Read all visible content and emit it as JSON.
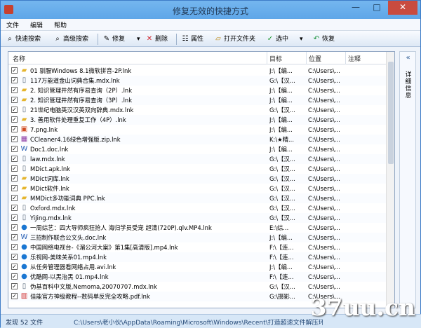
{
  "window": {
    "title": "修复无效的快捷方式",
    "controls": [
      "—",
      "□",
      "✕"
    ]
  },
  "menu": [
    "文件",
    "编辑",
    "帮助"
  ],
  "toolbar": {
    "quick_search": "快速搜索",
    "advanced_search": "高级搜索",
    "repair": "修复",
    "delete": "删除",
    "properties": "属性",
    "open_folder": "打开文件夹",
    "select": "选中",
    "restore": "恢复"
  },
  "icons": {
    "quick_search": "search-icon",
    "advanced_search": "search-icon",
    "repair": "wrench-icon",
    "delete": "delete-x-icon",
    "properties": "properties-icon",
    "open_folder": "folder-icon",
    "select": "check-icon",
    "restore": "restore-icon"
  },
  "table": {
    "headers": [
      "名称",
      "目标",
      "位置",
      "注释"
    ],
    "rows": [
      {
        "checked": true,
        "icon": "folder-icon",
        "name": "01 驯服Windows 8.1微软拼音-2P.lnk",
        "target": "J:\\【编...",
        "location": "C:\\Users\\..."
      },
      {
        "checked": true,
        "icon": "doc-icon",
        "name": "117万能道金山词典合集.mdx.lnk",
        "target": "G:\\【汉...",
        "location": "C:\\Users\\..."
      },
      {
        "checked": true,
        "icon": "folder-icon",
        "name": "2. 知识管理井然有序易查询（2P）.lnk",
        "target": "J:\\【编...",
        "location": "C:\\Users\\..."
      },
      {
        "checked": true,
        "icon": "folder-icon",
        "name": "2. 知识管理井然有序易查询（3P）.lnk",
        "target": "J:\\【编...",
        "location": "C:\\Users\\..."
      },
      {
        "checked": true,
        "icon": "doc-icon",
        "name": "21世纪电脑英汉汉英双向辞典.mdx.lnk",
        "target": "G:\\【汉...",
        "location": "C:\\Users\\..."
      },
      {
        "checked": true,
        "icon": "folder-icon",
        "name": "3. 善用软件处理重复工作（4P）.lnk",
        "target": "J:\\【编...",
        "location": "C:\\Users\\..."
      },
      {
        "checked": true,
        "icon": "png-icon",
        "name": "7.png.lnk",
        "target": "J:\\【编...",
        "location": "C:\\Users\\..."
      },
      {
        "checked": true,
        "icon": "zip-icon",
        "name": "CCleaner4.16绿色增强版.zip.lnk",
        "target": "K:\\★精...",
        "location": "C:\\Users\\..."
      },
      {
        "checked": true,
        "icon": "word-icon",
        "name": "Doc1.doc.lnk",
        "target": "J:\\【编...",
        "location": "C:\\Users\\..."
      },
      {
        "checked": true,
        "icon": "doc-icon",
        "name": "law.mdx.lnk",
        "target": "G:\\【汉...",
        "location": "C:\\Users\\..."
      },
      {
        "checked": true,
        "icon": "doc-icon",
        "name": "MDict.apk.lnk",
        "target": "G:\\【汉...",
        "location": "C:\\Users\\..."
      },
      {
        "checked": true,
        "icon": "folder-icon",
        "name": "MDict词库.lnk",
        "target": "G:\\【汉...",
        "location": "C:\\Users\\..."
      },
      {
        "checked": true,
        "icon": "folder-icon",
        "name": "MDict软件.lnk",
        "target": "G:\\【汉...",
        "location": "C:\\Users\\..."
      },
      {
        "checked": true,
        "icon": "folder-icon",
        "name": "MMDict多功能词典 PPC.lnk",
        "target": "G:\\【汉...",
        "location": "C:\\Users\\..."
      },
      {
        "checked": true,
        "icon": "doc-icon",
        "name": "Oxford.mdx.lnk",
        "target": "G:\\【汉...",
        "location": "C:\\Users\\..."
      },
      {
        "checked": true,
        "icon": "doc-icon",
        "name": "YiJing.mdx.lnk",
        "target": "G:\\【汉...",
        "location": "C:\\Users\\..."
      },
      {
        "checked": true,
        "icon": "video-icon",
        "name": "一周综艺：四大导师疯狂抢人 海归学员受宠 超清(720P).qlv.MP4.lnk",
        "target": "E:\\综...",
        "location": "C:\\Users\\..."
      },
      {
        "checked": true,
        "icon": "word-icon",
        "name": "三招制作联合公文头.doc.lnk",
        "target": "J:\\【编...",
        "location": "C:\\Users\\..."
      },
      {
        "checked": true,
        "icon": "video-icon",
        "name": "中国网络电视台-《湄公河大案》第1集[高清版].mp4.lnk",
        "target": "F:\\【连...",
        "location": "C:\\Users\\..."
      },
      {
        "checked": true,
        "icon": "video-icon",
        "name": "乐视网-美味关系01.mp4.lnk",
        "target": "F:\\【连...",
        "location": "C:\\Users\\..."
      },
      {
        "checked": true,
        "icon": "video-icon",
        "name": "从任务管理器看网络占用.avi.lnk",
        "target": "J:\\【编...",
        "location": "C:\\Users\\..."
      },
      {
        "checked": true,
        "icon": "video-icon",
        "name": "优酷网-以黑治黑 01.mp4.lnk",
        "target": "F:\\【连...",
        "location": "C:\\Users\\..."
      },
      {
        "checked": true,
        "icon": "doc-icon",
        "name": "伪基百科中文版,Nemoma,20070707.mdx.lnk",
        "target": "G:\\【汉...",
        "location": "C:\\Users\\..."
      },
      {
        "checked": true,
        "icon": "pdf-icon",
        "name": "佳能官方神级教程--数码单反完全攻略.pdf.lnk",
        "target": "G:\\摄影...",
        "location": "C:\\Users\\..."
      }
    ]
  },
  "side_panel": {
    "collapse_icon": "«",
    "label": "详细信息"
  },
  "status": {
    "count": "发现 52 文件",
    "path": "C:\\Users\\老小伙\\AppData\\Roaming\\Microsoft\\Windows\\Recent\\打造超速文件解压环"
  },
  "watermark": "37uu.cn"
}
